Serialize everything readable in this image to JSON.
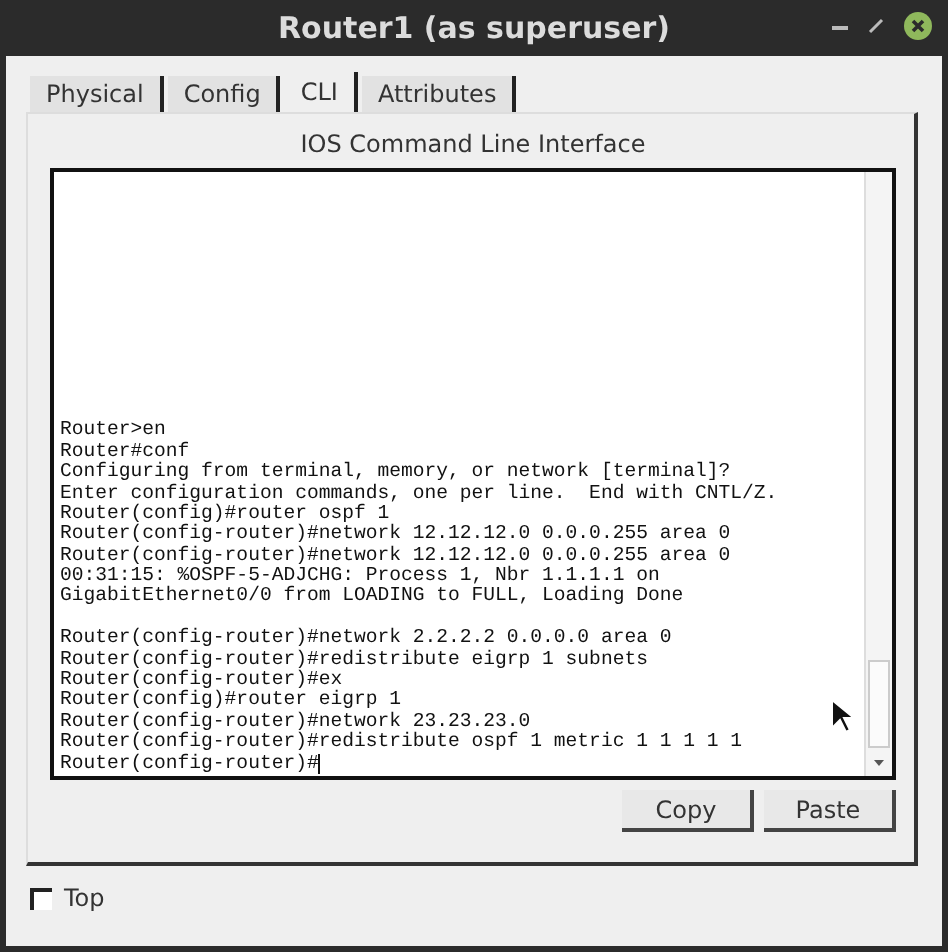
{
  "window": {
    "title": "Router1 (as superuser)"
  },
  "tabs": [
    {
      "label": "Physical",
      "selected": false
    },
    {
      "label": "Config",
      "selected": false
    },
    {
      "label": "CLI",
      "selected": true
    },
    {
      "label": "Attributes",
      "selected": false
    }
  ],
  "panel_title": "IOS Command Line Interface",
  "terminal": {
    "blocks": [
      [
        "Router>en",
        "Router#conf",
        "Configuring from terminal, memory, or network [terminal]?",
        "Enter configuration commands, one per line.  End with CNTL/Z.",
        "Router(config)#router ospf 1",
        "Router(config-router)#network 12.12.12.0 0.0.0.255 area 0",
        "Router(config-router)#network 12.12.12.0 0.0.0.255 area 0",
        "00:31:15: %OSPF-5-ADJCHG: Process 1, Nbr 1.1.1.1 on",
        "GigabitEthernet0/0 from LOADING to FULL, Loading Done"
      ],
      [
        "Router(config-router)#network 2.2.2.2 0.0.0.0 area 0",
        "Router(config-router)#redistribute eigrp 1 subnets",
        "Router(config-router)#ex",
        "Router(config)#router eigrp 1",
        "Router(config-router)#network 23.23.23.0",
        "Router(config-router)#redistribute ospf 1 metric 1 1 1 1 1",
        "Router(config-router)#"
      ]
    ]
  },
  "buttons": [
    {
      "label": "Copy"
    },
    {
      "label": "Paste"
    }
  ],
  "top_checkbox": {
    "label": "Top",
    "checked": false
  }
}
